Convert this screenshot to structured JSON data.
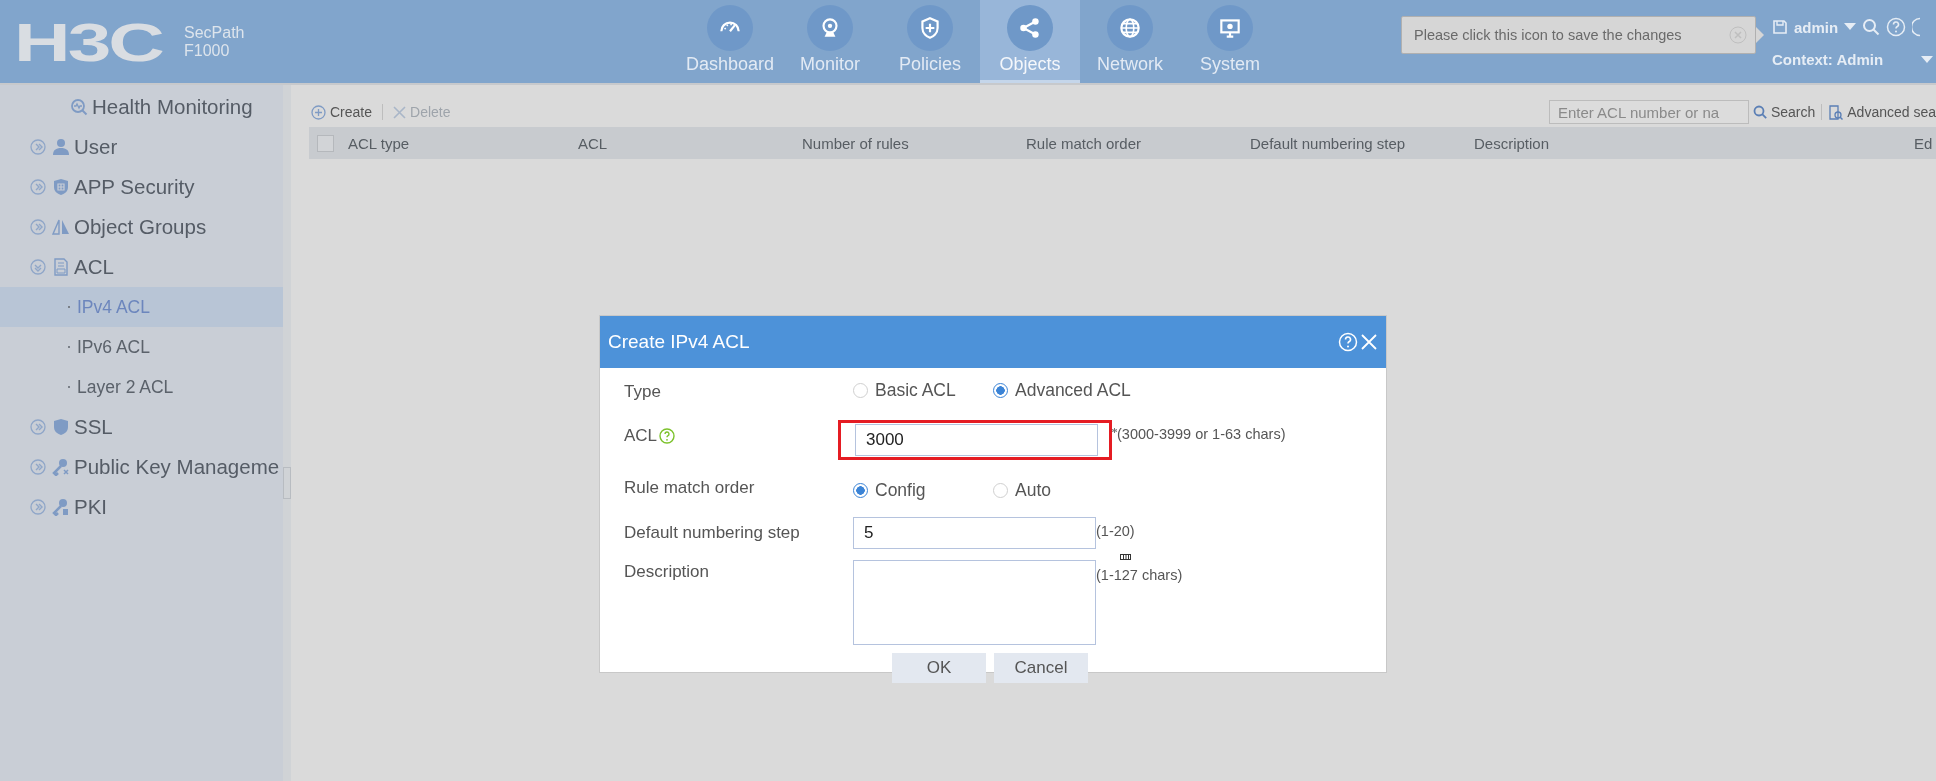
{
  "header": {
    "logo": "H3C",
    "product": [
      "SecPath",
      "F1000"
    ],
    "nav": [
      {
        "label": "Dashboard",
        "selected": false
      },
      {
        "label": "Monitor",
        "selected": false
      },
      {
        "label": "Policies",
        "selected": false
      },
      {
        "label": "Objects",
        "selected": true
      },
      {
        "label": "Network",
        "selected": false
      },
      {
        "label": "System",
        "selected": false
      }
    ],
    "tooltip": "Please click this icon to save the changes",
    "user": "admin",
    "context": "Context: Admin"
  },
  "sidebar": {
    "items": [
      {
        "kind": "link",
        "label": "Health Monitoring"
      },
      {
        "kind": "group",
        "label": "User",
        "expanded": false
      },
      {
        "kind": "group",
        "label": "APP Security",
        "expanded": false
      },
      {
        "kind": "group",
        "label": "Object Groups",
        "expanded": false
      },
      {
        "kind": "group",
        "label": "ACL",
        "expanded": true,
        "children": [
          {
            "label": "IPv4 ACL",
            "selected": true
          },
          {
            "label": "IPv6 ACL",
            "selected": false
          },
          {
            "label": "Layer 2 ACL",
            "selected": false
          }
        ]
      },
      {
        "kind": "group",
        "label": "SSL",
        "expanded": false
      },
      {
        "kind": "group",
        "label": "Public Key Manageme",
        "expanded": false
      },
      {
        "kind": "group",
        "label": "PKI",
        "expanded": false
      }
    ]
  },
  "toolbar": {
    "buttons": [
      {
        "label": "Create",
        "disabled": false
      },
      {
        "label": "Delete",
        "disabled": true
      }
    ],
    "search": {
      "placeholder": "Enter ACL number or na"
    },
    "search_button": "Search",
    "advanced": "Advanced sea"
  },
  "table": {
    "select_all": {
      "checked": false
    },
    "columns": [
      "ACL type",
      "ACL",
      "Number of rules",
      "Rule match order",
      "Default numbering step",
      "Description",
      "Ed"
    ]
  },
  "dialog": {
    "title": "Create IPv4 ACL",
    "fields": [
      {
        "kind": "radio",
        "label": "Type",
        "options": [
          {
            "label": "Basic ACL",
            "selected": false
          },
          {
            "label": "Advanced ACL",
            "selected": true
          }
        ]
      },
      {
        "kind": "input",
        "label": "ACL",
        "help": true,
        "value": "3000",
        "required": true,
        "highlighted": true,
        "hint": "(3000-3999 or 1-63 chars)"
      },
      {
        "kind": "radio",
        "label": "Rule match order",
        "options": [
          {
            "label": "Config",
            "selected": true
          },
          {
            "label": "Auto",
            "selected": false
          }
        ]
      },
      {
        "kind": "input",
        "label": "Default numbering step",
        "help": false,
        "value": "5",
        "required": false,
        "highlighted": false,
        "hint": "(1-20)"
      },
      {
        "kind": "textarea",
        "label": "Description",
        "hint": "(1-127 chars)"
      }
    ],
    "buttons": [
      "OK",
      "Cancel"
    ]
  }
}
